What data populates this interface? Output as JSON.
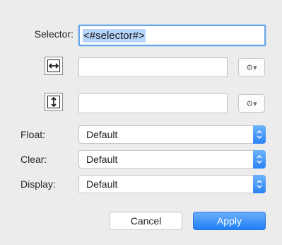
{
  "selector": {
    "label": "Selector:",
    "value": "<#selector#>"
  },
  "width_row": {
    "icon": "horizontal-size-icon",
    "value": "",
    "gear_icon": "gear-icon"
  },
  "height_row": {
    "icon": "vertical-size-icon",
    "value": "",
    "gear_icon": "gear-icon"
  },
  "float": {
    "label": "Float:",
    "value": "Default"
  },
  "clear": {
    "label": "Clear:",
    "value": "Default"
  },
  "display": {
    "label": "Display:",
    "value": "Default"
  },
  "buttons": {
    "cancel": "Cancel",
    "apply": "Apply"
  },
  "colors": {
    "accent": "#2b84f5",
    "selection": "#b5d5fb",
    "background": "#ececec"
  }
}
